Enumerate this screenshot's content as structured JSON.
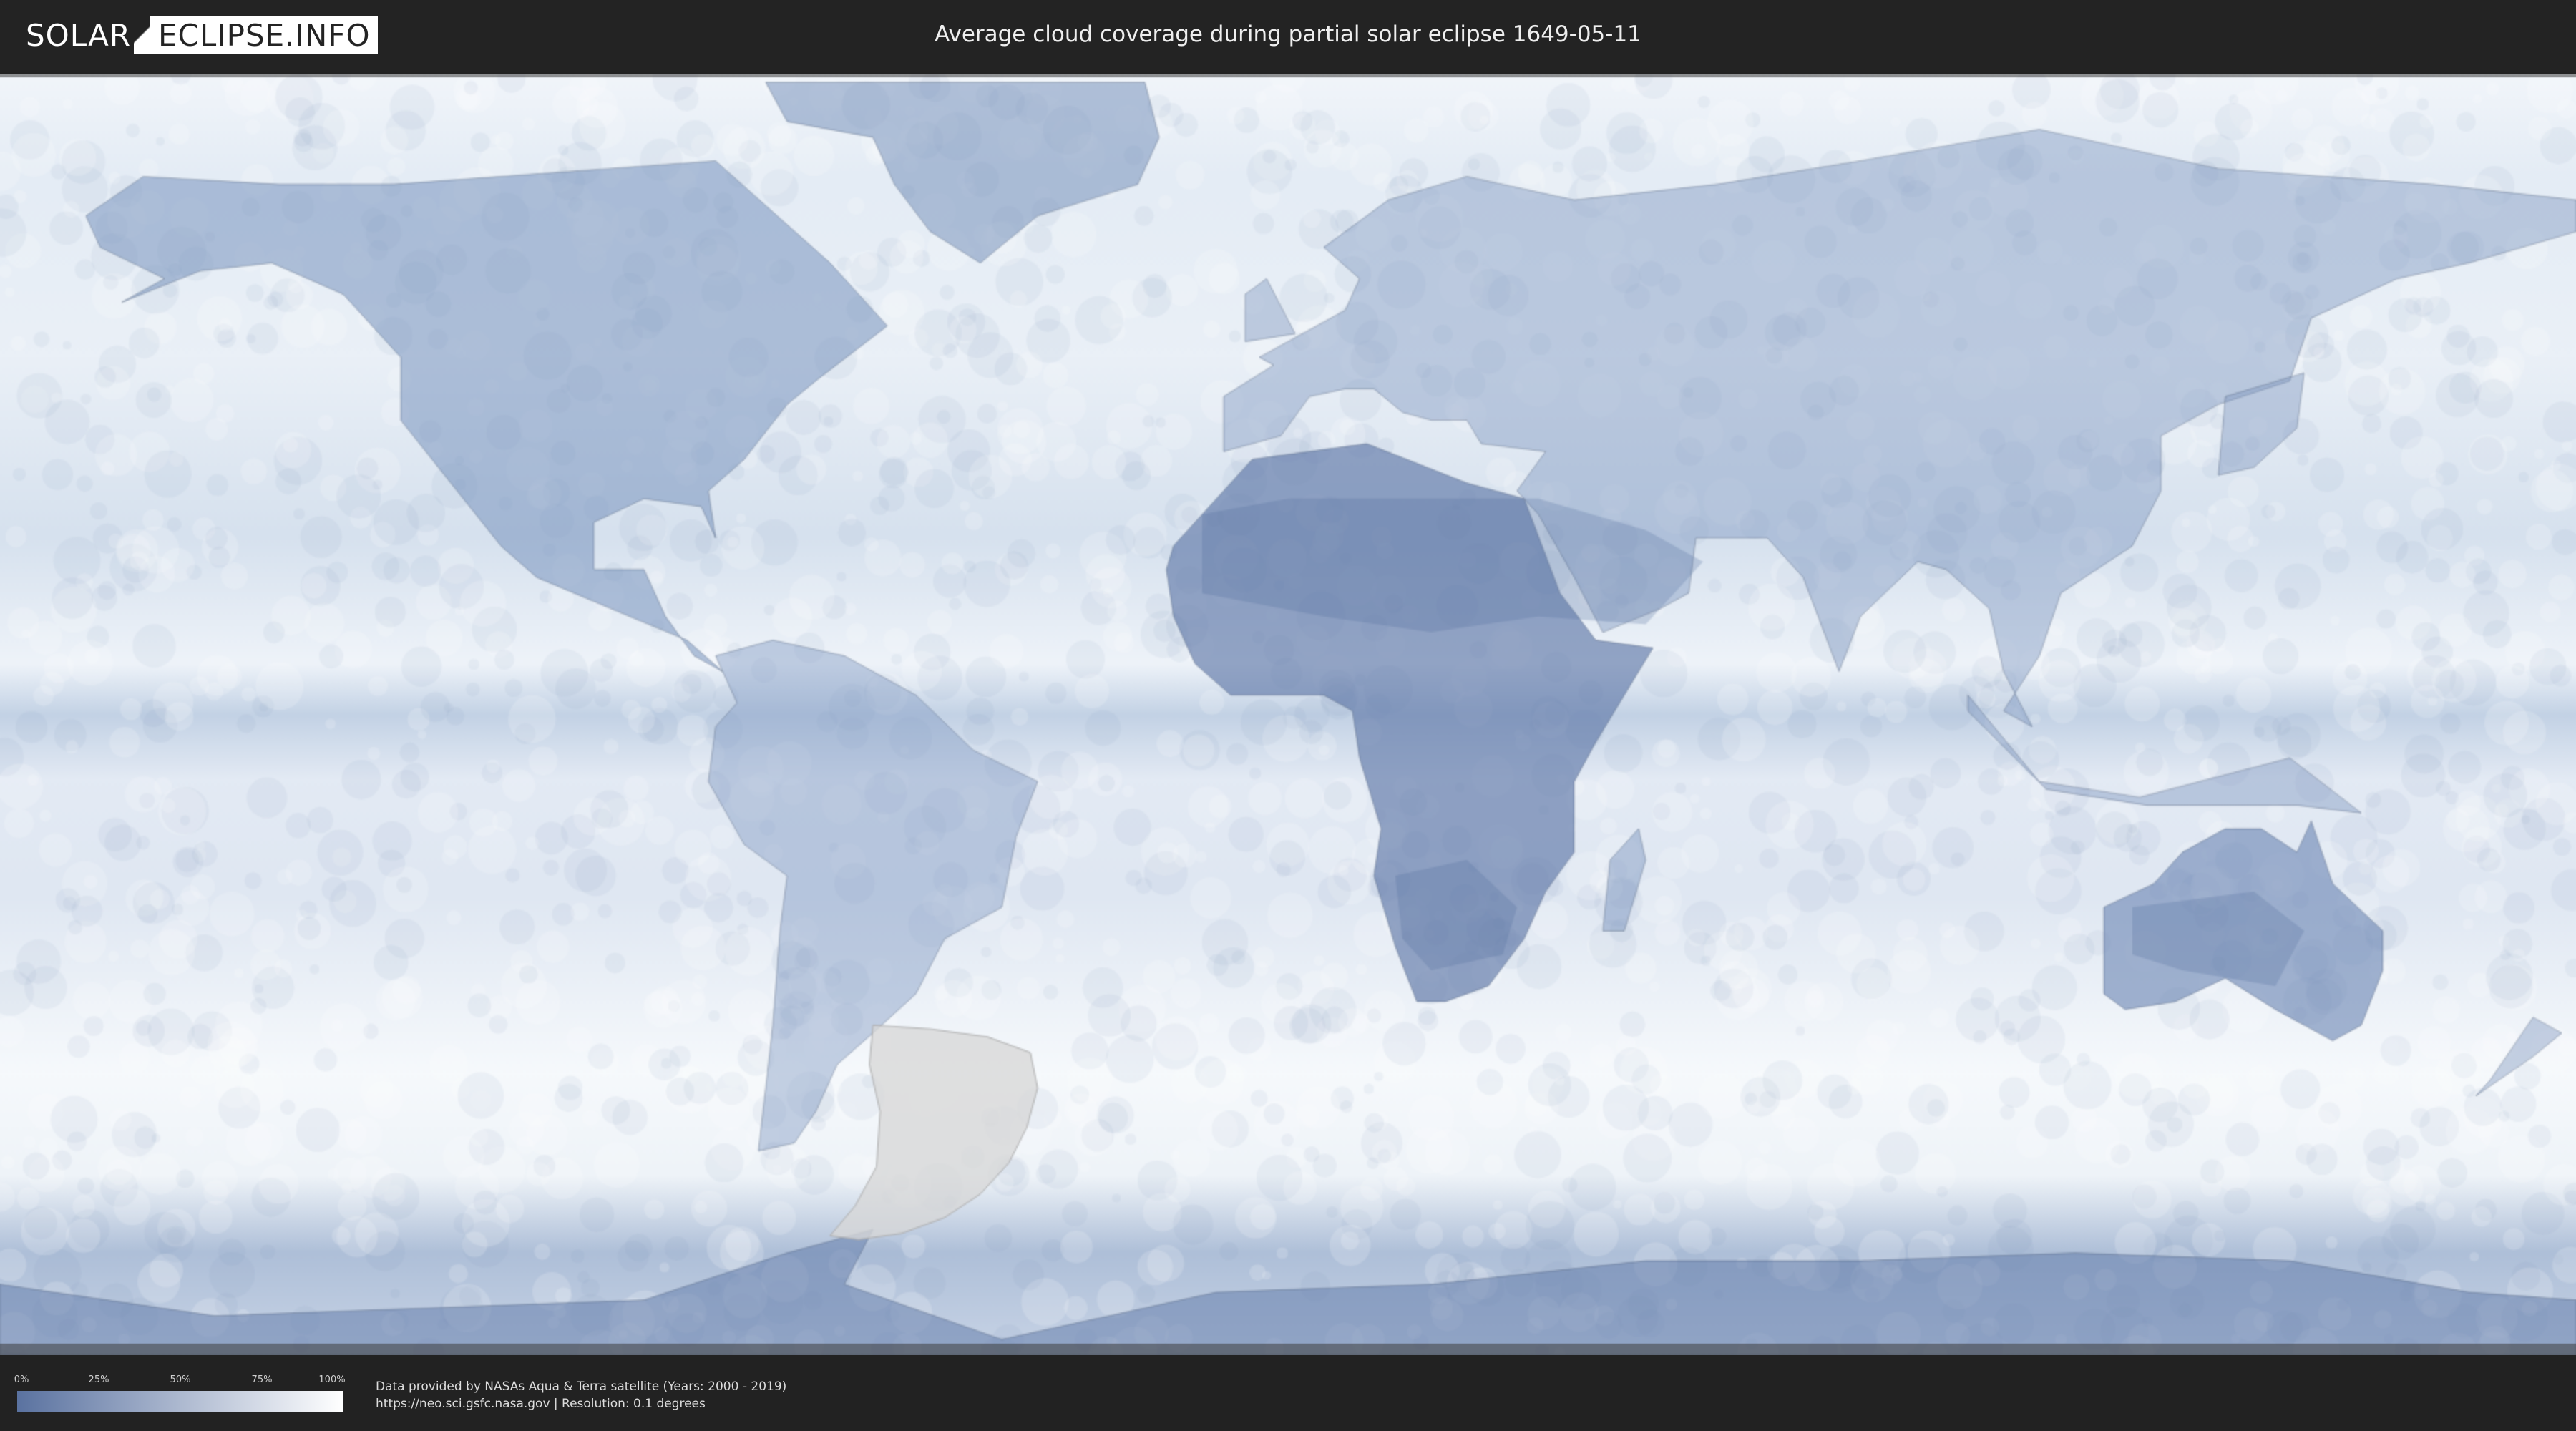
{
  "header": {
    "logo_left": "SOLAR",
    "logo_right": "ECLIPSE.INFO",
    "title": "Average cloud coverage during partial solar eclipse 1649-05-11"
  },
  "map": {
    "projection": "equirectangular",
    "colors": {
      "clear_sky": "#5a72a0",
      "full_cloud": "#ffffff",
      "eclipse_zone": "#d9d9d9",
      "background": "#222222"
    },
    "eclipse_zone_outline": [
      [
        -58,
        -37
      ],
      [
        -50,
        -37.5
      ],
      [
        -42,
        -38.5
      ],
      [
        -36,
        -40.5
      ],
      [
        -35,
        -45
      ],
      [
        -36.5,
        -50
      ],
      [
        -39,
        -54.5
      ],
      [
        -43,
        -58.5
      ],
      [
        -48,
        -61.5
      ],
      [
        -54,
        -63.5
      ],
      [
        -60,
        -64.3
      ],
      [
        -64,
        -63.8
      ],
      [
        -60.5,
        -60
      ],
      [
        -57.5,
        -55
      ],
      [
        -57,
        -48
      ],
      [
        -58.5,
        -42
      ],
      [
        -58,
        -37
      ]
    ]
  },
  "legend": {
    "ticks": [
      "0%",
      "25%",
      "50%",
      "75%",
      "100%"
    ],
    "gradient_start": "#5a72a0",
    "gradient_end": "#ffffff"
  },
  "footer": {
    "credit_line1": "Data provided by NASAs Aqua & Terra satellite (Years: 2000 - 2019)",
    "credit_line2": "https://neo.sci.gsfc.nasa.gov | Resolution: 0.1 degrees"
  }
}
